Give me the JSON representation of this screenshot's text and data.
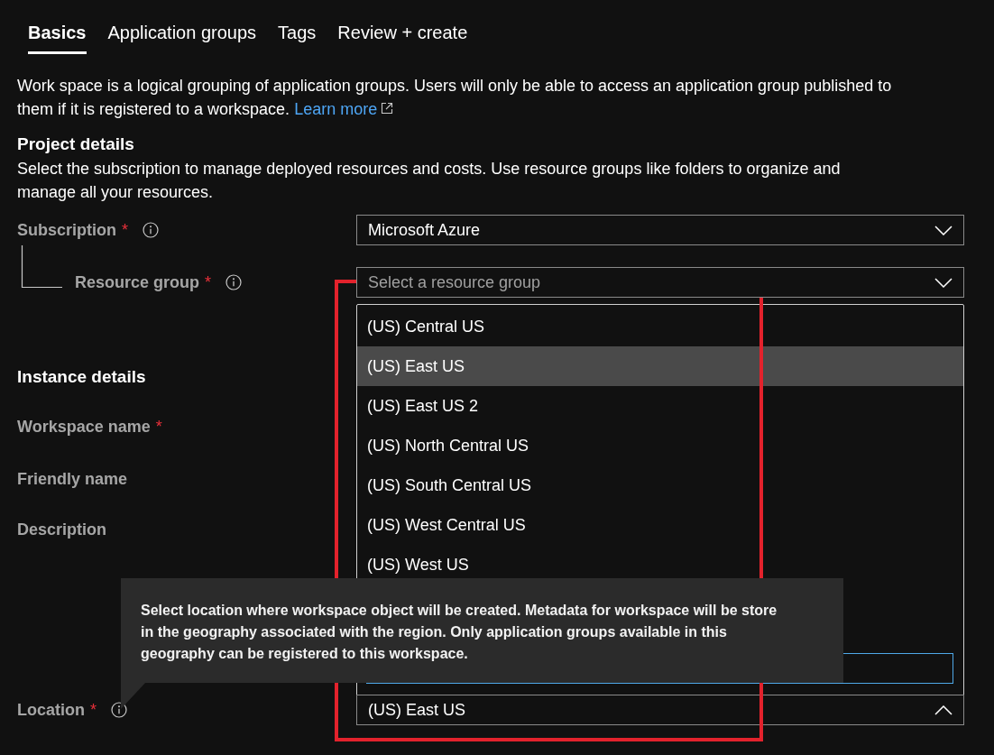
{
  "tabs": [
    {
      "label": "Basics",
      "selected": true
    },
    {
      "label": "Application groups",
      "selected": false
    },
    {
      "label": "Tags",
      "selected": false
    },
    {
      "label": "Review + create",
      "selected": false
    }
  ],
  "intro": {
    "text": "Work space is a logical grouping of application groups. Users will only be able to access an application group published to them if it is registered to a workspace.",
    "link": "Learn more"
  },
  "required_mark": "*",
  "project_details": {
    "title": "Project details",
    "description": "Select the subscription to manage deployed resources and costs. Use resource groups like folders to organize and manage all your resources.",
    "fields": [
      {
        "label": "Subscription",
        "required": true,
        "info": true,
        "nested": false,
        "value": "Microsoft Azure"
      },
      {
        "label": "Resource group",
        "required": true,
        "info": true,
        "nested": true,
        "placeholder": "Select a resource group"
      }
    ]
  },
  "instance_details": {
    "title": "Instance details",
    "fields": [
      {
        "label": "Workspace name",
        "required": true,
        "info": false,
        "tall": false
      },
      {
        "label": "Friendly name",
        "required": false,
        "info": false,
        "tall": false
      },
      {
        "label": "Description",
        "required": false,
        "info": false,
        "tall": true
      }
    ]
  },
  "location": {
    "label": "Location",
    "required": true,
    "info": true,
    "value": "(US) East US",
    "expanded": true,
    "options": [
      {
        "label": "(US) Central US",
        "selected": false
      },
      {
        "label": "(US) East US",
        "selected": true
      },
      {
        "label": "(US) East US 2",
        "selected": false
      },
      {
        "label": "(US) North Central US",
        "selected": false
      },
      {
        "label": "(US) South Central US",
        "selected": false
      },
      {
        "label": "(US) West Central US",
        "selected": false
      },
      {
        "label": "(US) West US",
        "selected": false
      }
    ]
  },
  "tooltip": {
    "text": "Select location where workspace object will be created. Metadata for workspace will be store in the geography associated with the region. Only application groups available in this geography can be registered to this workspace."
  }
}
